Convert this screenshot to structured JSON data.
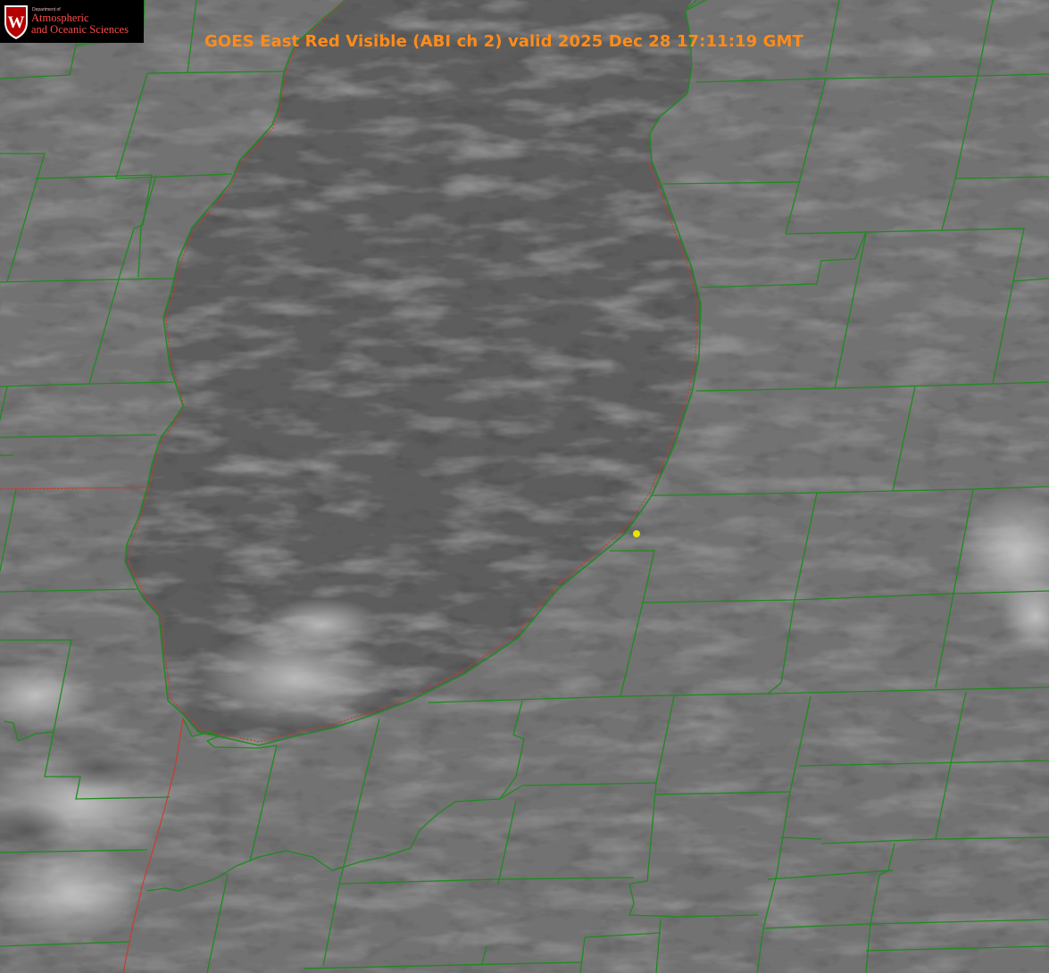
{
  "title": "GOES East Red Visible (ABI ch 2) valid 2025 Dec 28 17:11:19 GMT",
  "logo": {
    "department": "Department of",
    "line1": "Atmospheric",
    "line2": "and Oceanic Sciences",
    "letter": "W"
  },
  "colors": {
    "title": "#ff8c1a",
    "county_lines": "#1f8a1f",
    "state_lines": "#cc3a2a",
    "marker": "#e6e600",
    "land": "#6f6f6f",
    "lake": "#5a5a5a"
  }
}
